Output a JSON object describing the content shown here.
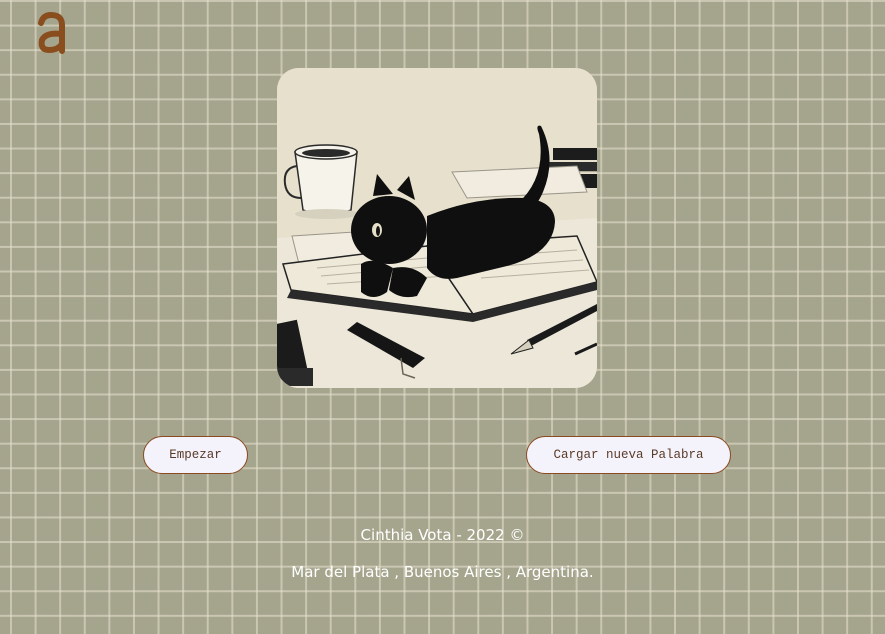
{
  "logo": {
    "icon": "letter-a-logo-icon",
    "text": "a",
    "color": "#8a4e1e"
  },
  "hero": {
    "icon": "black-cat-on-book-illustration"
  },
  "buttons": {
    "start_label": "Empezar",
    "load_label": "Cargar nueva Palabra"
  },
  "footer": {
    "credit": "Cinthia Vota - 2022 ©",
    "location": "Mar del Plata , Buenos Aires , Argentina."
  },
  "colors": {
    "background": "#a5a58e",
    "button_border": "#8a4a22",
    "button_bg": "#f4f3fb"
  }
}
